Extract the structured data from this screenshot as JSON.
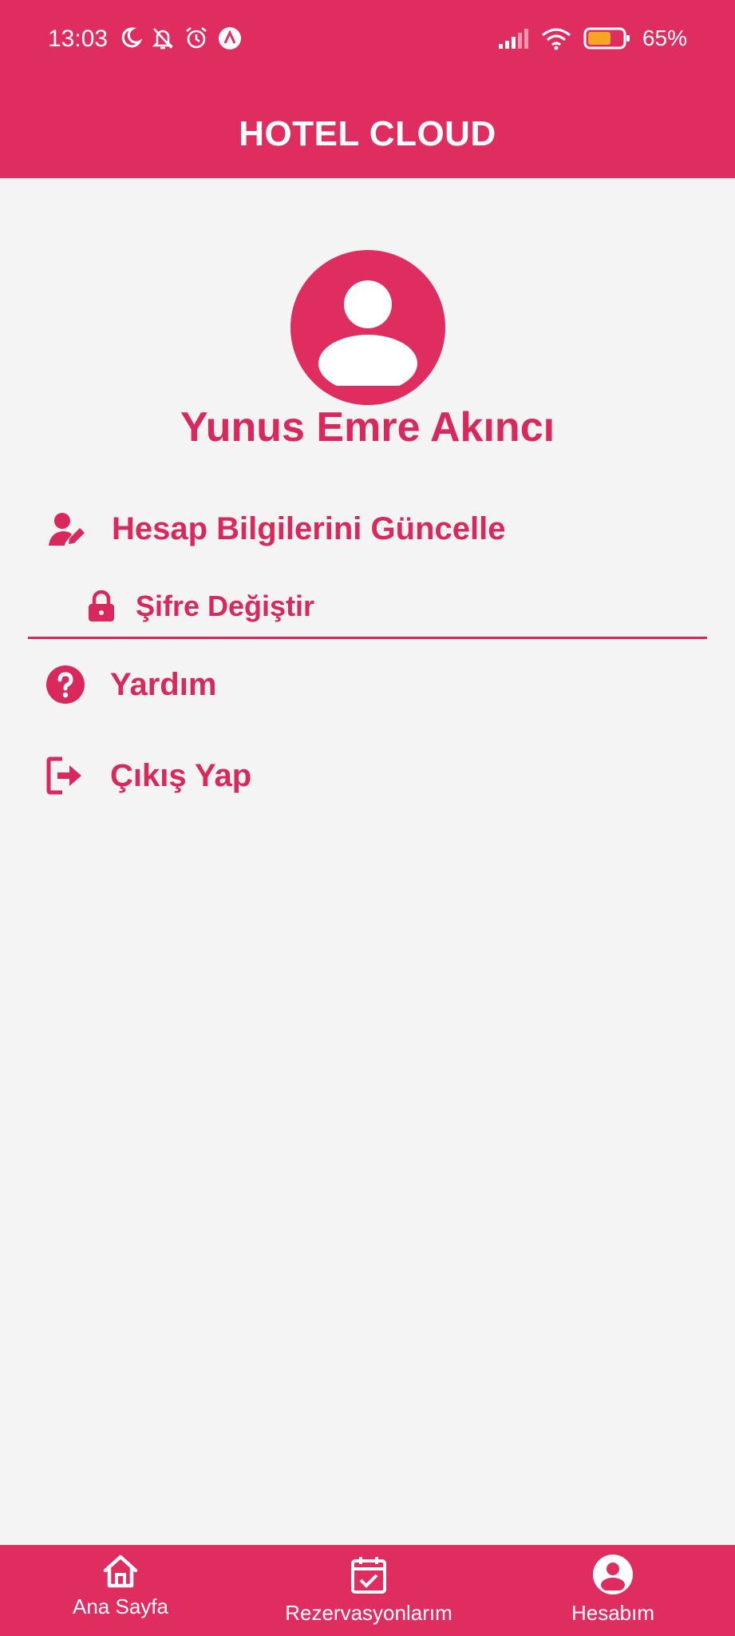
{
  "status_bar": {
    "time": "13:03",
    "battery_percent": "65%"
  },
  "app": {
    "title": "HOTEL CLOUD"
  },
  "profile": {
    "name": "Yunus Emre Akıncı"
  },
  "menu": {
    "update_account": "Hesap Bilgilerini Güncelle",
    "change_password": "Şifre Değiştir",
    "help": "Yardım",
    "logout": "Çıkış Yap"
  },
  "bottom_nav": {
    "home": "Ana Sayfa",
    "reservations": "Rezervasyonlarım",
    "account": "Hesabım"
  },
  "colors": {
    "brand": "#df2d60",
    "accent_text": "#d9285b",
    "background": "#f4f4f4"
  }
}
